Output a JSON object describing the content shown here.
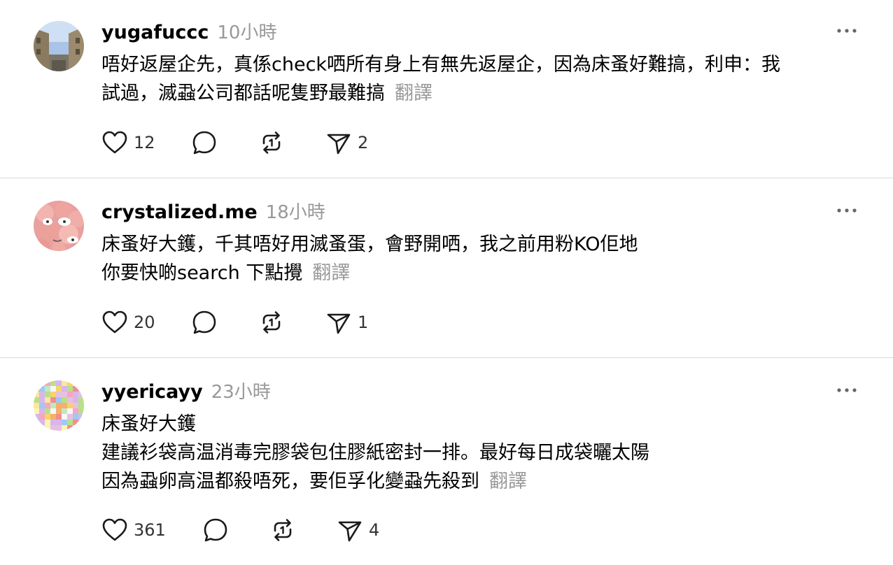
{
  "posts": [
    {
      "username": "yugafuccc",
      "time": "10小時",
      "lines": [
        "唔好返屋企先，真係check哂所有身上有無先返屋企，因為床蚤好難搞，利申：我",
        "試過，滅蝨公司都話呢隻野最難搞"
      ],
      "translate": "翻譯",
      "likes": "12",
      "shares": "2"
    },
    {
      "username": "crystalized.me",
      "time": "18小時",
      "lines": [
        "床蚤好大鑊，千其唔好用滅蚤蛋，會野開哂，我之前用粉KO佢地",
        "你要快啲search 下點攪"
      ],
      "translate": "翻譯",
      "likes": "20",
      "shares": "1"
    },
    {
      "username": "yyericayy",
      "time": "23小時",
      "lines": [
        "床蚤好大鑊",
        "建議衫袋高温消毒完膠袋包住膠紙密封一排。最好每日成袋曬太陽",
        "因為蝨卵高温都殺唔死，要佢孚化變蝨先殺到"
      ],
      "translate": "翻譯",
      "likes": "361",
      "shares": "4"
    }
  ],
  "icons": {
    "like": "heart-icon",
    "reply": "comment-icon",
    "repost": "repost-icon",
    "share": "send-icon",
    "more": "more-horizontal-icon"
  },
  "colors": {
    "secondary_text": "#999999",
    "divider": "#d9d9d9",
    "icon": "#1a1a1a"
  }
}
